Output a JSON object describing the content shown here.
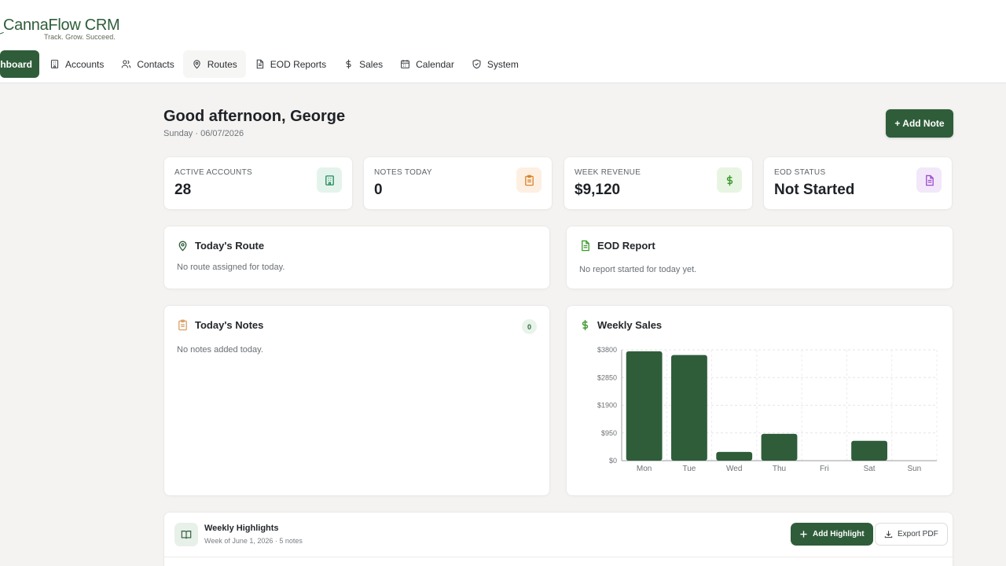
{
  "brand": {
    "name_main": "CannaFlow",
    "name_suffix": "CRM",
    "tagline": "Track. Grow. Succeed."
  },
  "nav": {
    "items": [
      {
        "label": "Dashboard",
        "icon": "home-icon",
        "active": true
      },
      {
        "label": "Accounts",
        "icon": "building-icon"
      },
      {
        "label": "Contacts",
        "icon": "users-icon"
      },
      {
        "label": "Routes",
        "icon": "map-pin-icon"
      },
      {
        "label": "EOD Reports",
        "icon": "file-text-icon"
      },
      {
        "label": "Sales",
        "icon": "dollar-icon"
      },
      {
        "label": "Calendar",
        "icon": "calendar-icon"
      },
      {
        "label": "System",
        "icon": "shield-icon"
      }
    ]
  },
  "greeting": {
    "title": "Good afternoon, George",
    "subtitle": "Sunday · 06/07/2026",
    "add_note_label": "+ Add Note"
  },
  "stats": [
    {
      "label": "ACTIVE ACCOUNTS",
      "value": "28",
      "icon": "building-icon",
      "color": "#1f8a5b",
      "bg": "#e4f4ec"
    },
    {
      "label": "NOTES TODAY",
      "value": "0",
      "icon": "clipboard-icon",
      "color": "#d9822b",
      "bg": "#fdf0e2"
    },
    {
      "label": "WEEK REVENUE",
      "value": "$9,120",
      "icon": "dollar-icon",
      "color": "#3c9a2e",
      "bg": "#e8f5e3"
    },
    {
      "label": "EOD STATUS",
      "value": "Not Started",
      "icon": "file-text-icon",
      "color": "#9b4dca",
      "bg": "#f3e8fa"
    }
  ],
  "route_panel": {
    "title": "Today's Route",
    "empty_text": "No route assigned for today.",
    "icon_color": "#2f5d3a"
  },
  "eod_panel": {
    "title": "EOD Report",
    "empty_text": "No report started for today yet.",
    "icon_color": "#3c9a2e"
  },
  "notes_panel": {
    "title": "Today's Notes",
    "empty_text": "No notes added today.",
    "count": "0",
    "icon_color": "#d9a066"
  },
  "sales_panel": {
    "title": "Weekly Sales",
    "icon_color": "#3c9a2e"
  },
  "chart_data": {
    "type": "bar",
    "title": "Weekly Sales",
    "categories": [
      "Mon",
      "Tue",
      "Wed",
      "Thu",
      "Fri",
      "Sat",
      "Sun"
    ],
    "values": [
      3750,
      3620,
      300,
      920,
      0,
      680,
      0
    ],
    "ylim": [
      0,
      3800
    ],
    "yticks": [
      "$0",
      "$950",
      "$1900",
      "$2850",
      "$3800"
    ],
    "ytick_values": [
      0,
      950,
      1900,
      2850,
      3800
    ],
    "grid": true,
    "bar_color": "#2f5d3a"
  },
  "highlights": {
    "title": "Weekly Highlights",
    "subtitle": "Week of June 1, 2026 · 5 notes",
    "add_label": "Add Highlight",
    "export_label": "Export PDF"
  }
}
